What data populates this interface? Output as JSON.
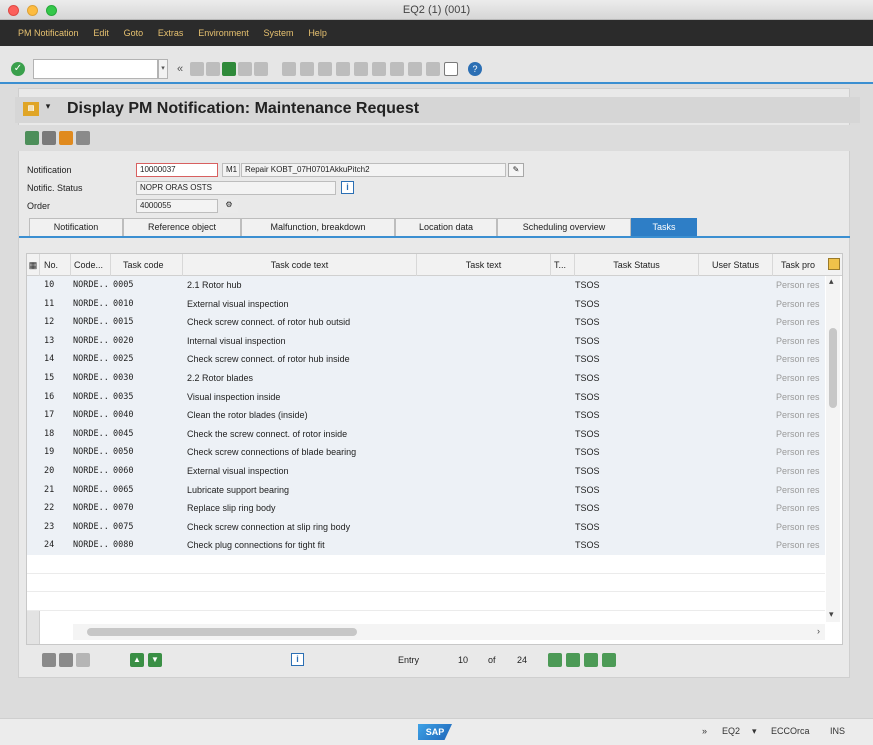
{
  "window": {
    "title": "EQ2 (1) (001)"
  },
  "menu": [
    "PM Notification",
    "Edit",
    "Goto",
    "Extras",
    "Environment",
    "System",
    "Help"
  ],
  "toolbar": {
    "command_value": "",
    "double_arrow": "«"
  },
  "screen": {
    "title": "Display PM Notification: Maintenance Request"
  },
  "header": {
    "notification_label": "Notification",
    "notification_value": "10000037",
    "type_value": "M1",
    "description_value": "Repair KOBT_07H0701AkkuPitch2",
    "status_label": "Notific. Status",
    "status_value": "NOPR ORAS OSTS",
    "order_label": "Order",
    "order_value": "4000055"
  },
  "tabs": [
    {
      "label": "Notification",
      "active": false
    },
    {
      "label": "Reference object",
      "active": false
    },
    {
      "label": "Malfunction, breakdown",
      "active": false
    },
    {
      "label": "Location data",
      "active": false
    },
    {
      "label": "Scheduling overview",
      "active": false
    },
    {
      "label": "Tasks",
      "active": true
    }
  ],
  "grid": {
    "columns": [
      "No.",
      "Code...",
      "Task code",
      "Task code text",
      "Task text",
      "T...",
      "Task Status",
      "User Status",
      "Task pro"
    ],
    "rows": [
      {
        "no": "10",
        "code": "NORDE..",
        "task_code": "0005",
        "text": "2.1 Rotor hub",
        "status": "TSOS",
        "processor": "Person res"
      },
      {
        "no": "11",
        "code": "NORDE..",
        "task_code": "0010",
        "text": "External visual inspection",
        "status": "TSOS",
        "processor": "Person res"
      },
      {
        "no": "12",
        "code": "NORDE..",
        "task_code": "0015",
        "text": "Check screw connect. of rotor hub outsid",
        "status": "TSOS",
        "processor": "Person res"
      },
      {
        "no": "13",
        "code": "NORDE..",
        "task_code": "0020",
        "text": "Internal visual inspection",
        "status": "TSOS",
        "processor": "Person res"
      },
      {
        "no": "14",
        "code": "NORDE..",
        "task_code": "0025",
        "text": "Check screw connect. of rotor hub inside",
        "status": "TSOS",
        "processor": "Person res"
      },
      {
        "no": "15",
        "code": "NORDE..",
        "task_code": "0030",
        "text": "2.2 Rotor blades",
        "status": "TSOS",
        "processor": "Person res"
      },
      {
        "no": "16",
        "code": "NORDE..",
        "task_code": "0035",
        "text": "Visual inspection inside",
        "status": "TSOS",
        "processor": "Person res"
      },
      {
        "no": "17",
        "code": "NORDE..",
        "task_code": "0040",
        "text": "Clean the rotor blades (inside)",
        "status": "TSOS",
        "processor": "Person res"
      },
      {
        "no": "18",
        "code": "NORDE..",
        "task_code": "0045",
        "text": "Check the screw connect. of rotor inside",
        "status": "TSOS",
        "processor": "Person res"
      },
      {
        "no": "19",
        "code": "NORDE..",
        "task_code": "0050",
        "text": "Check screw connections of blade bearing",
        "status": "TSOS",
        "processor": "Person res"
      },
      {
        "no": "20",
        "code": "NORDE..",
        "task_code": "0060",
        "text": "External visual inspection",
        "status": "TSOS",
        "processor": "Person res"
      },
      {
        "no": "21",
        "code": "NORDE..",
        "task_code": "0065",
        "text": "Lubricate support bearing",
        "status": "TSOS",
        "processor": "Person res"
      },
      {
        "no": "22",
        "code": "NORDE..",
        "task_code": "0070",
        "text": "Replace slip ring body",
        "status": "TSOS",
        "processor": "Person res"
      },
      {
        "no": "23",
        "code": "NORDE..",
        "task_code": "0075",
        "text": "Check screw connection at slip ring body",
        "status": "TSOS",
        "processor": "Person res"
      },
      {
        "no": "24",
        "code": "NORDE..",
        "task_code": "0080",
        "text": "Check plug connections for tight fit",
        "status": "TSOS",
        "processor": "Person res"
      }
    ]
  },
  "entry": {
    "label": "Entry",
    "current": "10",
    "of_label": "of",
    "total": "24"
  },
  "statusbar": {
    "arrows": "»",
    "system": "EQ2",
    "host": "ECCOrca",
    "mode": "INS"
  },
  "logo": "SAP"
}
